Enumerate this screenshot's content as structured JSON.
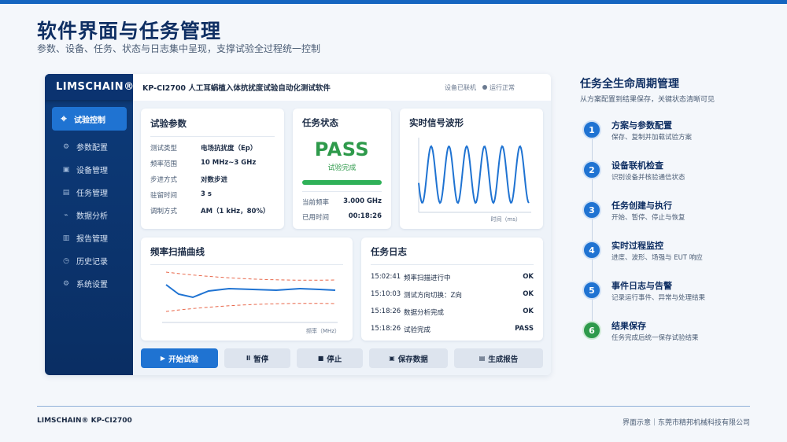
{
  "header": {
    "title": "软件界面与任务管理",
    "subtitle": "参数、设备、任务、状态与日志集中呈现，支撑试验全过程统一控制"
  },
  "app": {
    "brand": "LIMSCHAIN®",
    "window_title": "KP-CI2700 人工耳蜗植入体抗扰度试验自动化测试软件",
    "status_device": "设备已联机",
    "status_run": "运行正常",
    "nav": [
      {
        "icon": "target-icon",
        "label": "试验控制",
        "active": true
      },
      {
        "icon": "gear-icon",
        "label": "参数配置"
      },
      {
        "icon": "device-icon",
        "label": "设备管理"
      },
      {
        "icon": "list-icon",
        "label": "任务管理"
      },
      {
        "icon": "chart-icon",
        "label": "数据分析"
      },
      {
        "icon": "report-icon",
        "label": "报告管理"
      },
      {
        "icon": "clock-icon",
        "label": "历史记录"
      },
      {
        "icon": "settings-icon",
        "label": "系统设置"
      }
    ],
    "params": {
      "title": "试验参数",
      "rows": [
        {
          "k": "测试类型",
          "v": "电场抗扰度（Ep）"
        },
        {
          "k": "频率范围",
          "v": "10 MHz~3 GHz"
        },
        {
          "k": "步进方式",
          "v": "对数步进"
        },
        {
          "k": "驻留时间",
          "v": "3 s"
        },
        {
          "k": "调制方式",
          "v": "AM（1 kHz，80%）"
        }
      ]
    },
    "task_state": {
      "title": "任务状态",
      "result": "PASS",
      "result_sub": "试验完成",
      "progress": 1.0,
      "freq_label": "当前频率",
      "freq_value": "3.000 GHz",
      "time_label": "已用时间",
      "time_value": "00:18:26"
    },
    "waveform": {
      "title": "实时信号波形",
      "xlabel": "时间（ms）"
    },
    "sweep": {
      "title": "频率扫描曲线",
      "xlabel": "频率（MHz）"
    },
    "log": {
      "title": "任务日志",
      "rows": [
        {
          "t": "15:02:41",
          "m": "频率扫描进行中",
          "r": "OK"
        },
        {
          "t": "15:10:03",
          "m": "测试方向切换：Z向",
          "r": "OK"
        },
        {
          "t": "15:18:26",
          "m": "数据分析完成",
          "r": "OK"
        },
        {
          "t": "15:18:26",
          "m": "试验完成",
          "r": "PASS"
        }
      ]
    },
    "buttons": [
      {
        "icon": "play-icon",
        "glyph": "▶",
        "label": "开始试验",
        "primary": true
      },
      {
        "icon": "pause-icon",
        "glyph": "Ⅱ",
        "label": "暂停"
      },
      {
        "icon": "stop-icon",
        "glyph": "■",
        "label": "停止"
      },
      {
        "icon": "save-icon",
        "glyph": "▣",
        "label": "保存数据"
      },
      {
        "icon": "report-icon",
        "glyph": "▤",
        "label": "生成报告"
      }
    ]
  },
  "lifecycle": {
    "title": "任务全生命周期管理",
    "subtitle": "从方案配置到结果保存，关键状态清晰可见",
    "steps": [
      {
        "n": "1",
        "title": "方案与参数配置",
        "desc": "保存、复制并加载试验方案"
      },
      {
        "n": "2",
        "title": "设备联机检查",
        "desc": "识别设备并核验通信状态"
      },
      {
        "n": "3",
        "title": "任务创建与执行",
        "desc": "开始、暂停、停止与恢复"
      },
      {
        "n": "4",
        "title": "实时过程监控",
        "desc": "进度、波形、场强与 EUT 响应"
      },
      {
        "n": "5",
        "title": "事件日志与告警",
        "desc": "记录运行事件、异常与处理结果"
      },
      {
        "n": "6",
        "title": "结果保存",
        "desc": "任务完成后统一保存试验结果"
      }
    ]
  },
  "footer": {
    "left": "LIMSCHAIN®   KP-CI2700",
    "right": "界面示意｜东莞市精邦机械科技有限公司"
  },
  "colors": {
    "accent": "#1f73d2",
    "navy": "#0d3b7a",
    "pass_green": "#2e9a4b",
    "limit_red": "#e8674a"
  }
}
